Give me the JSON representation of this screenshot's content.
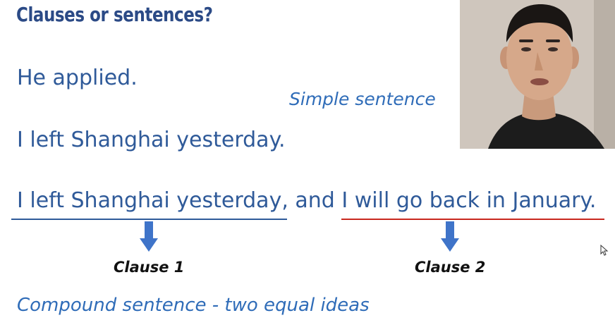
{
  "slide": {
    "title": "Clauses or sentences?",
    "sentences": [
      "He applied.",
      "I left Shanghai yesterday.",
      "I left Shanghai yesterday, and I will go back in January."
    ],
    "handwritten": {
      "simple": "Simple sentence",
      "compound": "Compound sentence - two equal ideas"
    },
    "clause_labels": [
      "Clause 1",
      "Clause 2"
    ]
  },
  "colors": {
    "title": "#2b4a86",
    "text": "#2f5a99",
    "handwriting": "#2f6cb8",
    "clause1_underline": "#2f5a99",
    "clause2_underline": "#c8281e",
    "arrow": "#3f74c9"
  },
  "icons": {
    "arrows": "arrow-down-icon",
    "cursor": "mouse-pointer-icon"
  }
}
